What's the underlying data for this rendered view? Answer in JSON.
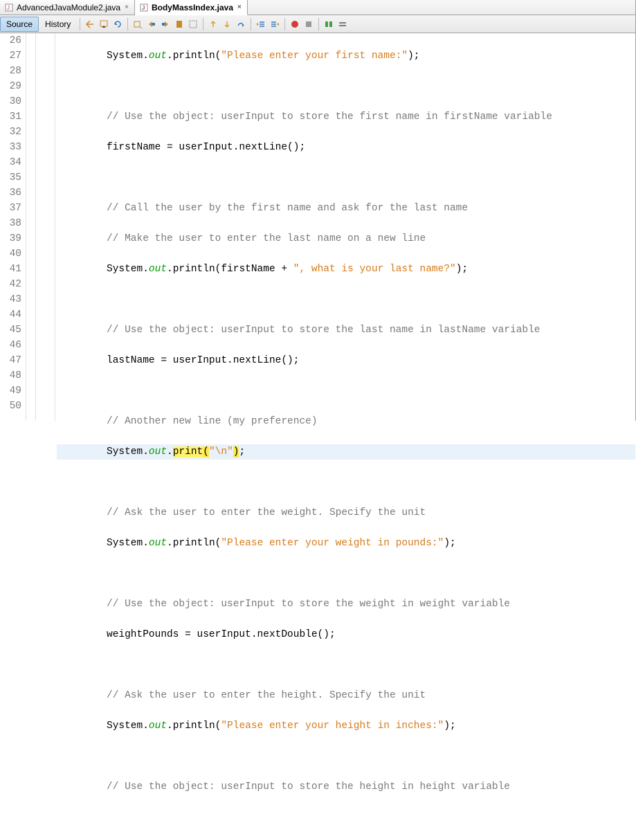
{
  "tabs": [
    {
      "label": "AdvancedJavaModule2.java",
      "active": false
    },
    {
      "label": "BodyMassIndex.java",
      "active": true
    }
  ],
  "subtabs": {
    "source": "Source",
    "history": "History"
  },
  "toolbar_icons": [
    "nav-back-icon",
    "nav-dropdown-icon",
    "refresh-icon",
    "find-icon",
    "find-prev-icon",
    "find-next-icon",
    "bookmark-icon",
    "select-icon",
    "step-up-icon",
    "step-down-icon",
    "step-over-icon",
    "indent-left-icon",
    "indent-right-icon",
    "record-icon",
    "stop-icon",
    "compare-icon",
    "wrap-icon"
  ],
  "lines": {
    "start": 26,
    "end": 50
  },
  "code": {
    "l26": {
      "pre": "System.",
      "out": "out",
      "mid": ".println(",
      "str": "\"Please enter your first name:\"",
      "post": ");"
    },
    "l28": "// Use the object: userInput to store the first name in firstName variable",
    "l29": "firstName = userInput.nextLine();",
    "l31": "// Call the user by the first name and ask for the last name",
    "l32": "// Make the user to enter the last name on a new line",
    "l33": {
      "pre": "System.",
      "out": "out",
      "mid": ".println(firstName + ",
      "str": "\", what is your last name?\"",
      "post": ");"
    },
    "l35": "// Use the object: userInput to store the last name in lastName variable",
    "l36": "lastName = userInput.nextLine();",
    "l38": "// Another new line (my preference)",
    "l39": {
      "pre": "System.",
      "out": "out",
      "mid": ".",
      "method": "print",
      "open": "(",
      "str": "\"\\n\"",
      "close": ")",
      "semi": ";"
    },
    "l41": "// Ask the user to enter the weight. Specify the unit",
    "l42": {
      "pre": "System.",
      "out": "out",
      "mid": ".println(",
      "str": "\"Please enter your weight in pounds:\"",
      "post": ");"
    },
    "l44": "// Use the object: userInput to store the weight in weight variable",
    "l45": "weightPounds = userInput.nextDouble();",
    "l47": "// Ask the user to enter the height. Specify the unit",
    "l48": {
      "pre": "System.",
      "out": "out",
      "mid": ".println(",
      "str": "\"Please enter your height in inches:\"",
      "post": ");"
    },
    "l50": "// Use the object: userInput to store the height in height variable"
  }
}
